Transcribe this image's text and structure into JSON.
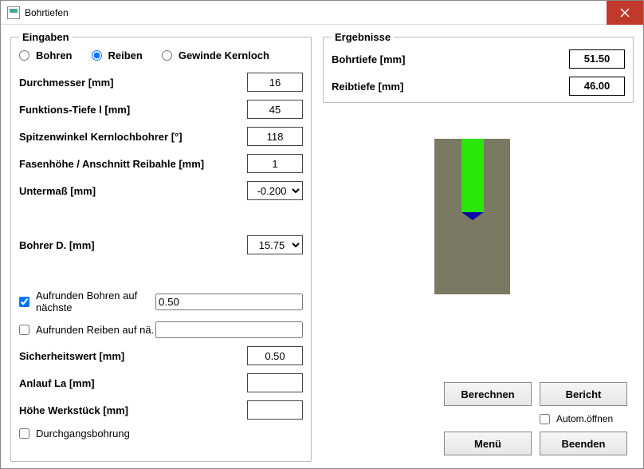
{
  "window": {
    "title": "Bohrtiefen"
  },
  "inputs": {
    "legend": "Eingaben",
    "radios": {
      "bohren": "Bohren",
      "reiben": "Reiben",
      "gewinde": "Gewinde Kernloch",
      "selected": "reiben"
    },
    "durchmesser_lbl": "Durchmesser [mm]",
    "durchmesser_val": "16",
    "funktionstiefe_lbl": "Funktions-Tiefe l [mm]",
    "funktionstiefe_val": "45",
    "spitzenwinkel_lbl": "Spitzenwinkel Kernlochbohrer [°]",
    "spitzenwinkel_val": "118",
    "fasenhoehe_lbl": "Fasenhöhe / Anschnitt Reibahle [mm]",
    "fasenhoehe_val": "1",
    "untermass_lbl": "Untermaß [mm]",
    "untermass_val": "-0.200",
    "bohrer_d_lbl": "Bohrer D. [mm]",
    "bohrer_d_val": "15.75",
    "aufrunden_bohren_lbl": "Aufrunden Bohren auf nächste",
    "aufrunden_bohren_chk": true,
    "aufrunden_bohren_val": "0.50",
    "aufrunden_reiben_lbl": "Aufrunden Reiben auf nä.",
    "aufrunden_reiben_chk": false,
    "aufrunden_reiben_val": "",
    "sicherheitswert_lbl": "Sicherheitswert [mm]",
    "sicherheitswert_val": "0.50",
    "anlauf_lbl": "Anlauf La [mm]",
    "anlauf_val": "",
    "hoehe_lbl": "Höhe Werkstück [mm]",
    "hoehe_val": "",
    "durchgang_lbl": "Durchgangsbohrung",
    "durchgang_chk": false
  },
  "results": {
    "legend": "Ergebnisse",
    "bohrtiefe_lbl": "Bohrtiefe [mm]",
    "bohrtiefe_val": "51.50",
    "reibtiefe_lbl": "Reibtiefe [mm]",
    "reibtiefe_val": "46.00"
  },
  "buttons": {
    "berechnen": "Berechnen",
    "bericht": "Bericht",
    "autom_oeffnen": "Autom.öffnen",
    "menue": "Menü",
    "beenden": "Beenden"
  }
}
